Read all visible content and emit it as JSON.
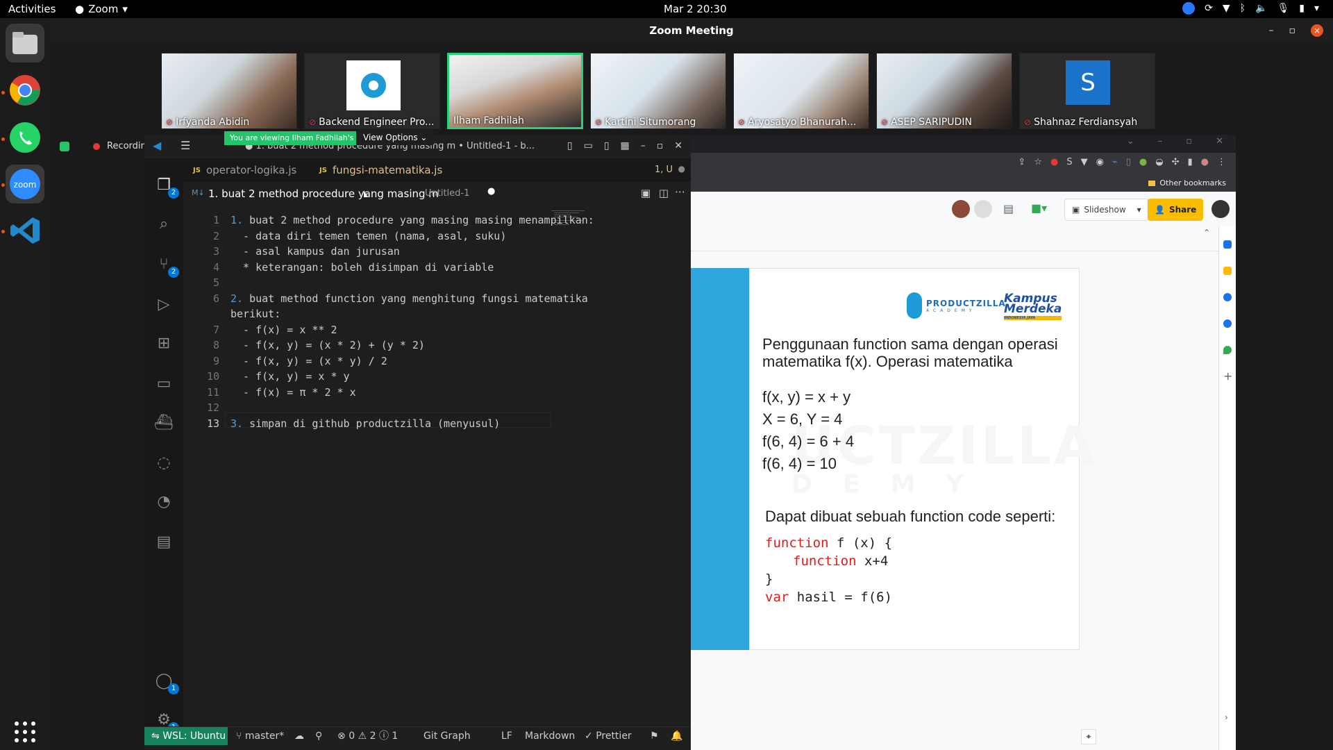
{
  "topbar": {
    "activities": "Activities",
    "app_name": "Zoom",
    "clock": "Mar 2  20:30"
  },
  "zoom": {
    "window_title": "Zoom Meeting",
    "viewing_banner": "You are viewing Ilham Fadhilah's screen",
    "view_options": "View Options",
    "recording": "Recording",
    "participants": [
      {
        "name": "Irfyanda Abidin"
      },
      {
        "name": "Backend Engineer Pro..."
      },
      {
        "name": "Ilham Fadhilah"
      },
      {
        "name": "Kartini Situmorang"
      },
      {
        "name": "Aryosatyo Bhanurah..."
      },
      {
        "name": "ASEP SARIPUDIN"
      },
      {
        "name": "Shahnaz Ferdiansyah",
        "initial": "S"
      }
    ]
  },
  "vscode": {
    "title": "● 1. buat 2 method procedure yang masing m • Untitled-1 - b...",
    "tabs": [
      {
        "label": "operator-logika.js",
        "icon": "JS"
      },
      {
        "label": "fungsi-matematika.js",
        "icon": "JS",
        "status": "1, U"
      }
    ],
    "editor_tab": {
      "icon": "M↓",
      "label": "1. buat 2 method procedure yang masing m",
      "desc": "Untitled-1"
    },
    "activity_badges": {
      "explorer": "2",
      "scm": "2",
      "accounts": "1",
      "settings": "1"
    },
    "lines": [
      {
        "n": "1",
        "num": "1.",
        "text": " buat 2 method procedure yang masing masing menampilkan:"
      },
      {
        "n": "2",
        "num": "",
        "text": "  - data diri temen temen (nama, asal, suku)"
      },
      {
        "n": "3",
        "num": "",
        "text": "  - asal kampus dan jurusan"
      },
      {
        "n": "4",
        "num": "",
        "text": "  * keterangan: boleh disimpan di variable"
      },
      {
        "n": "5",
        "num": "",
        "text": ""
      },
      {
        "n": "6",
        "num": "2.",
        "text": " buat method function yang menghitung fungsi matematika"
      },
      {
        "n": "",
        "num": "",
        "text": "berikut:"
      },
      {
        "n": "7",
        "num": "",
        "text": "  - f(x) = x ** 2"
      },
      {
        "n": "8",
        "num": "",
        "text": "  - f(x, y) = (x * 2) + (y * 2)"
      },
      {
        "n": "9",
        "num": "",
        "text": "  - f(x, y) = (x * y) / 2"
      },
      {
        "n": "10",
        "num": "",
        "text": "  - f(x, y) = x * y"
      },
      {
        "n": "11",
        "num": "",
        "text": "  - f(x) = π * 2 * x"
      },
      {
        "n": "12",
        "num": "",
        "text": ""
      },
      {
        "n": "13",
        "num": "3.",
        "text": " simpan di github productzilla (menyusul)"
      }
    ],
    "status": {
      "remote": "WSL: Ubuntu",
      "branch": "master*",
      "problems": "0",
      "warnings": "2",
      "infos": "1",
      "git_graph": "Git Graph",
      "eol": "LF",
      "language": "Markdown",
      "prettier": "Prettier"
    }
  },
  "browser": {
    "bookmarks": "Other bookmarks",
    "slideshow": "Slideshow",
    "share": "Share",
    "slide": {
      "brand": "PRODUCTZILLA",
      "brand_sub": "ACADEMY",
      "kampus_line1": "Kampus",
      "kampus_line2": "Merdeka",
      "kampus_bar": "INDONESIA JAYA",
      "watermark": "UCTZILLA",
      "watermark2": "DEMY",
      "intro": "Penggunaan function sama dengan operasi matematika f(x). Operasi matematika",
      "equations": [
        "f(x, y) = x + y",
        "X = 6, Y = 4",
        "f(6, 4) = 6 + 4",
        "f(6, 4) = 10"
      ],
      "dapat": "Dapat dibuat sebuah function code seperti:",
      "code": {
        "kw_function": "function",
        "l1_rest": " f (x) {",
        "l2_rest": " x+4",
        "l3": "}",
        "kw_var": "var",
        "l4_rest": " hasil = f(6)"
      }
    }
  },
  "colors": {
    "accent_green": "#24d27a",
    "vscode_bg": "#1e1e1e",
    "remote_green": "#16825d",
    "slide_blue": "#2fa6de",
    "share_yellow": "#fbbc04"
  }
}
